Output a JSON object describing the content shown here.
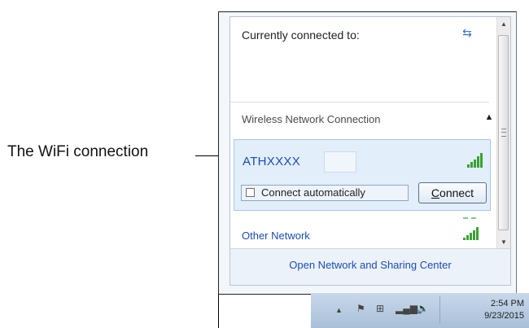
{
  "callout": {
    "text": "The WiFi connection"
  },
  "flyout": {
    "header_label": "Currently connected to:",
    "section_title": "Wireless Network Connection",
    "network": {
      "ssid": "ATHXXXX",
      "auto_label": "Connect automatically",
      "connect_button_prefix": "C",
      "connect_button_rest": "onnect"
    },
    "other_network": "Other Network",
    "footer_link": "Open Network and Sharing Center"
  },
  "taskbar": {
    "time": "2:54 PM",
    "date": "9/23/2015"
  },
  "colors": {
    "link_blue": "#1a4db5",
    "signal_green": "#3aa234",
    "selection_bg": "#e3eefb"
  }
}
